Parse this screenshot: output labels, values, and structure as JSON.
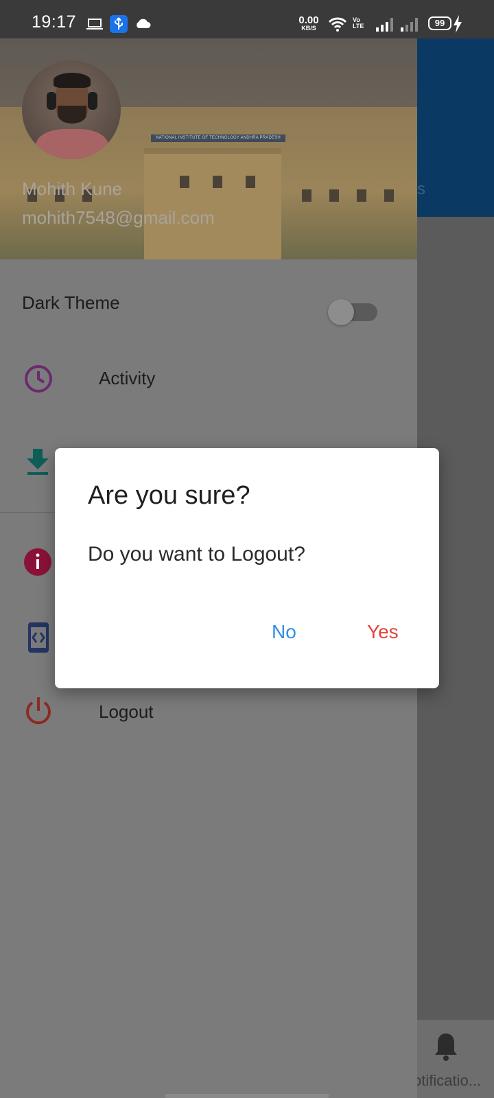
{
  "status_bar": {
    "time": "19:17",
    "net_speed_value": "0.00",
    "net_speed_unit": "KB/S",
    "volte_top": "Vo",
    "volte_bottom": "LTE",
    "battery": "99",
    "icons": [
      "laptop-icon",
      "usb-icon",
      "cloud-icon",
      "wifi-icon",
      "signal-icon",
      "battery-icon",
      "charging-icon"
    ]
  },
  "drawer": {
    "user_name": "Mohith Kune",
    "user_email": "mohith7548@gmail.com",
    "header_image_sign": "NATIONAL INSTITUTE OF TECHNOLOGY ANDHRA PRADESH",
    "dark_theme_label": "Dark Theme",
    "dark_theme_on": false,
    "items": [
      {
        "label": "Activity",
        "icon": "clock-icon",
        "color": "#6b2a6e"
      },
      {
        "label": "",
        "icon": "download-icon",
        "color": "#0d5e57"
      },
      {
        "label": "",
        "icon": "info-icon",
        "color": "#8a1238"
      },
      {
        "label": "",
        "icon": "code-icon",
        "color": "#243463"
      },
      {
        "label": "Logout",
        "icon": "power-icon",
        "color": "#8a2b24"
      }
    ]
  },
  "background_app": {
    "appbar_fragment": "s",
    "bottom_nav_label": "otificatio..."
  },
  "dialog": {
    "title": "Are you sure?",
    "message": "Do you want to Logout?",
    "no_label": "No",
    "yes_label": "Yes",
    "no_color": "#2f8ee5",
    "yes_color": "#e0453a"
  }
}
